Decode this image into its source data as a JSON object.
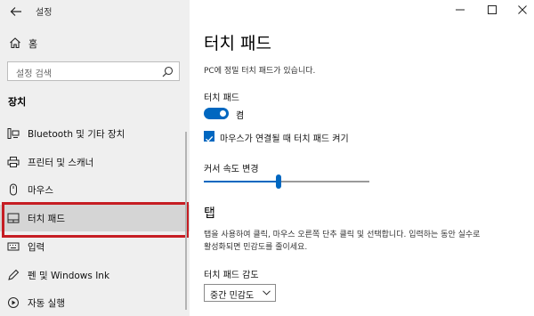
{
  "app_title": "설정",
  "home_label": "홈",
  "search": {
    "placeholder": "설정 검색"
  },
  "section_title": "장치",
  "nav_items": [
    {
      "label": "Bluetooth 및 기타 장치",
      "icon": "bluetooth-devices-icon"
    },
    {
      "label": "프린터 및 스캐너",
      "icon": "printer-icon"
    },
    {
      "label": "마우스",
      "icon": "mouse-icon"
    },
    {
      "label": "터치 패드",
      "icon": "touchpad-icon",
      "selected": true
    },
    {
      "label": "입력",
      "icon": "keyboard-icon"
    },
    {
      "label": "펜 및 Windows Ink",
      "icon": "pen-icon"
    },
    {
      "label": "자동 실행",
      "icon": "autoplay-icon"
    }
  ],
  "main": {
    "title": "터치 패드",
    "description": "PC에 정밀 터치 패드가 있습니다.",
    "touchpad_label": "터치 패드",
    "toggle": {
      "state": "켬",
      "on": true
    },
    "checkbox": {
      "label": "마우스가 연결될 때 터치 패드 켜기",
      "checked": true
    },
    "cursor_speed": {
      "label": "커서 속도 변경",
      "value_fraction": 0.45
    },
    "tap_heading": "탭",
    "tap_description": "탭을 사용하여 클릭, 마우스 오른쪽 단추 클릭 및 선택합니다. 입력하는 동안 실수로 활성화되면 민감도를 줄이세요.",
    "sensitivity": {
      "label": "터치 패드 감도",
      "value": "중간 민감도"
    }
  },
  "colors": {
    "accent": "#0067c0",
    "highlight_border": "#c61d23",
    "sidebar_bg": "#efefef"
  }
}
